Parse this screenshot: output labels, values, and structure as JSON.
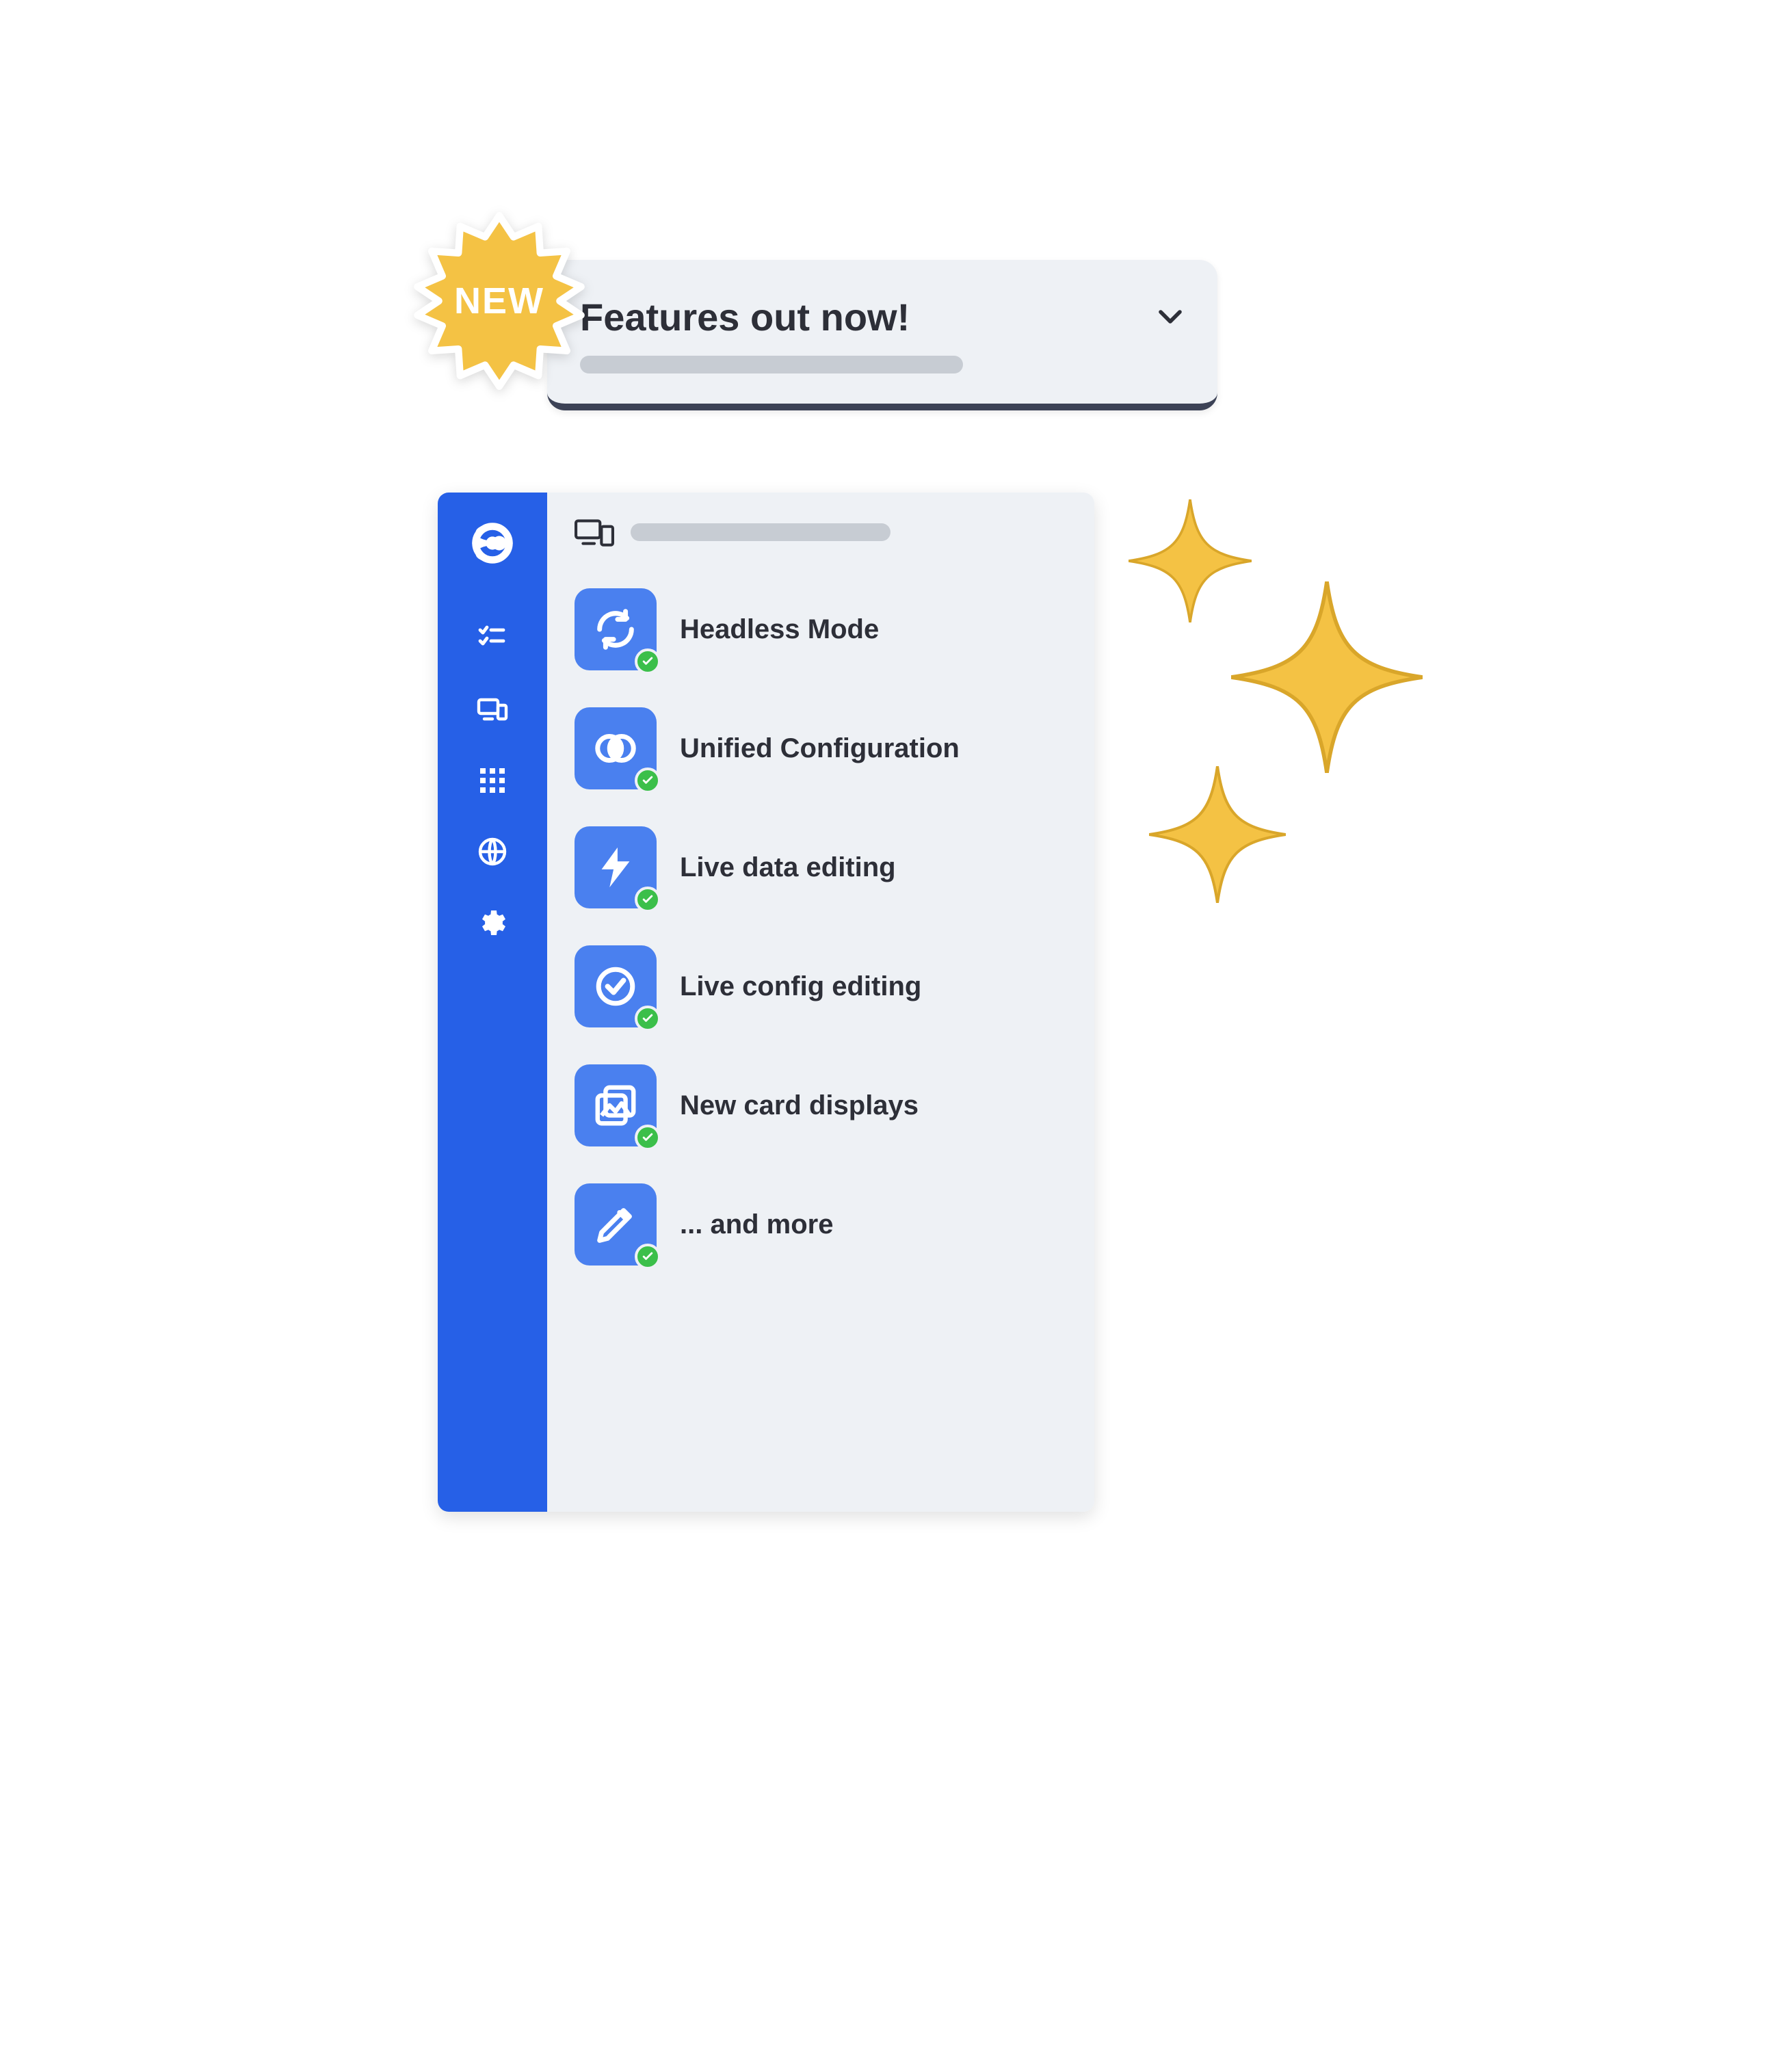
{
  "badge": {
    "label": "NEW"
  },
  "dropdown": {
    "title": "Features out now!"
  },
  "features": {
    "items": [
      {
        "label": "Headless Mode",
        "icon": "refresh-icon"
      },
      {
        "label": "Unified Configuration",
        "icon": "venn-icon"
      },
      {
        "label": "Live data editing",
        "icon": "lightning-icon"
      },
      {
        "label": "Live config editing",
        "icon": "check-circle-icon"
      },
      {
        "label": "New card displays",
        "icon": "image-stack-icon"
      },
      {
        "label": "... and more",
        "icon": "pencil-icon"
      }
    ]
  }
}
